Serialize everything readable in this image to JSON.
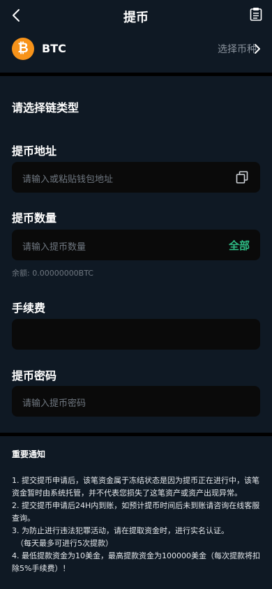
{
  "header": {
    "title": "提币"
  },
  "coin": {
    "logo_glyph": "₿",
    "symbol": "BTC",
    "select_label": "选择币种"
  },
  "chain": {
    "heading": "请选择链类型"
  },
  "address": {
    "heading": "提币地址",
    "placeholder": "请输入或粘贴钱包地址"
  },
  "amount": {
    "heading": "提币数量",
    "placeholder": "请输入提币数量",
    "all_label": "全部",
    "balance": "余额: 0.00000000BTC"
  },
  "fee": {
    "heading": "手续费",
    "value": ""
  },
  "password": {
    "heading": "提币密码",
    "placeholder": "请输入提币密码"
  },
  "notice": {
    "title": "重要通知",
    "lines": [
      "1. 提交提币申请后，该笔资金属于冻结状态是因为提币正在进行中，该笔资金暂时由系统托管，并不代表您损失了这笔资产或资产出现异常。",
      "2. 提交提币申请后24H内到账，如预计提币时间后未到账请咨询在线客服查询。",
      "3. 为防止进行违法犯罪活动，请在提取资金时，进行实名认证。",
      "（每天最多可进行5次提款）",
      "4. 最低提款资金为10美金，最高提款资金为100000美金（每次提款将扣除5%手续费）！"
    ]
  },
  "colors": {
    "background": "#0f1924",
    "accent_green": "#2ebd85",
    "btc_orange": "#f7931a",
    "field_bg": "#0a0a0a"
  },
  "icons": {
    "back": "chevron-left-icon",
    "clipboard": "clipboard-icon",
    "copy": "copy-icon",
    "select": "chevron-right-icon"
  }
}
